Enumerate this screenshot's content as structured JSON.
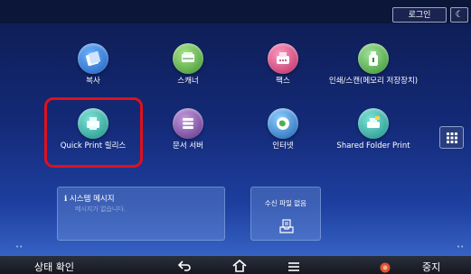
{
  "topbar": {
    "login_label": "로그인",
    "theme_icon": "moon-icon"
  },
  "apps": [
    {
      "label": "복사",
      "icon": "copy-icon",
      "color": "#3a7fd4"
    },
    {
      "label": "스캐너",
      "icon": "scanner-icon",
      "color": "#5bb04a"
    },
    {
      "label": "팩스",
      "icon": "fax-icon",
      "color": "#d94a7e"
    },
    {
      "label": "인쇄/스캔(메모리 저장장치)",
      "icon": "usb-icon",
      "color": "#4fae4a"
    },
    {
      "label": "Quick Print 릴리스",
      "icon": "quick-print-icon",
      "color": "#2fa79f"
    },
    {
      "label": "문서 서버",
      "icon": "document-server-icon",
      "color": "#7a4a9e"
    },
    {
      "label": "인터넷",
      "icon": "globe-icon",
      "color": "#2a78c8"
    },
    {
      "label": "Shared Folder Print",
      "icon": "shared-folder-print-icon",
      "color": "#2fa79f"
    }
  ],
  "widgets": {
    "message_title": "시스템 메시지",
    "message_body": "메시지가 없습니다.",
    "receive_title": "수신 파일 없음"
  },
  "bottombar": {
    "status_label": "상태 확인",
    "stop_label": "중지"
  }
}
